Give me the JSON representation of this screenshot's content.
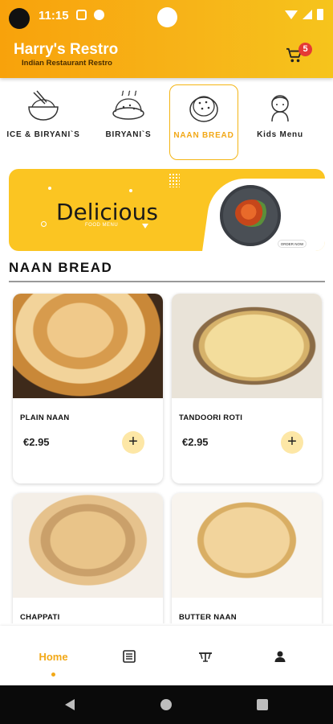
{
  "status_bar": {
    "time": "11:15"
  },
  "header": {
    "title": "Harry's Restro",
    "subtitle": "Indian Restaurant Restro",
    "cart_count": "5",
    "accent": "#f7b318"
  },
  "categories": [
    {
      "label": "ICE & BIRYANI`S",
      "icon": "rice-bowl-icon",
      "selected": false
    },
    {
      "label": "BIRYANI`S",
      "icon": "biryani-icon",
      "selected": false
    },
    {
      "label": "NAAN BREAD",
      "icon": "naan-bread-icon",
      "selected": true
    },
    {
      "label": "Kids Menu",
      "icon": "kid-icon",
      "selected": false
    }
  ],
  "banner": {
    "title": "Delicious",
    "subtitle": "FOOD MENU",
    "button": "ORDER NOW"
  },
  "section": {
    "title": "NAAN BREAD"
  },
  "products": [
    {
      "name": "PLAIN NAAN",
      "price": "€2.95",
      "add_label": "+"
    },
    {
      "name": "TANDOORI ROTI",
      "price": "€2.95",
      "add_label": "+"
    },
    {
      "name": "CHAPPATI",
      "price": "",
      "add_label": "+"
    },
    {
      "name": "BUTTER NAAN",
      "price": "",
      "add_label": "+"
    }
  ],
  "bottom_nav": {
    "items": [
      {
        "label": "Home",
        "icon": "home",
        "active": true
      },
      {
        "label": "",
        "icon": "menu-list-icon",
        "active": false
      },
      {
        "label": "",
        "icon": "table-icon",
        "active": false
      },
      {
        "label": "",
        "icon": "profile-icon",
        "active": false
      }
    ]
  }
}
